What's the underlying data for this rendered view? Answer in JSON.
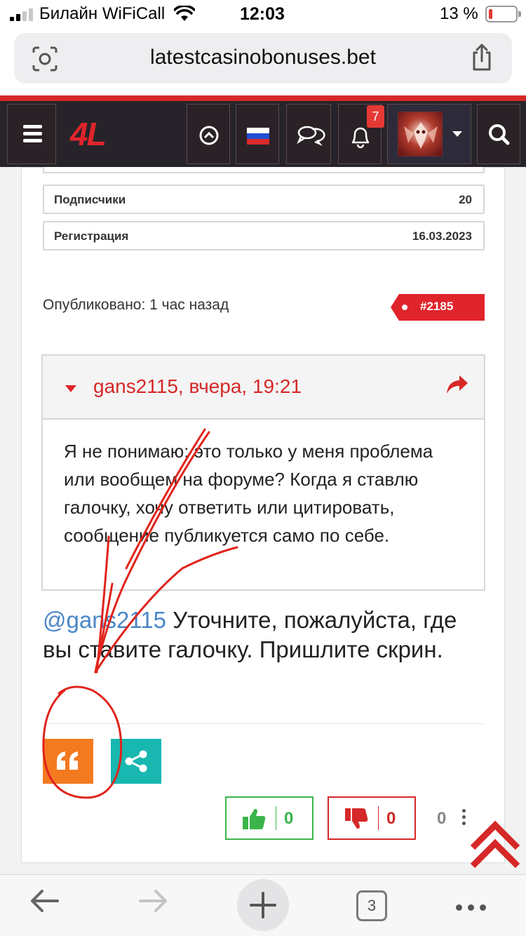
{
  "status_bar": {
    "carrier": "Билайн WiFiCall",
    "time": "12:03",
    "battery": "13 %",
    "battery_level_pct": 13
  },
  "browser": {
    "url": "latestcasinobonuses.bet",
    "tab_count": "3"
  },
  "site_nav": {
    "logo": "4L",
    "notification_count": "7"
  },
  "profile_stats": [
    {
      "label": "Подписчики",
      "value": "20"
    },
    {
      "label": "Регистрация",
      "value": "16.03.2023"
    }
  ],
  "post": {
    "published": "Опубликовано: 1 час назад",
    "number": "#2185",
    "quote_author": "gans2115, вчера, 19:21",
    "quote_text": "Я не понимаю: это только у меня про­блема или вообщем на форуме? Ко­гда я ставлю галочку, хочу ответить или цитировать, сообщение публику­ется само по себе.",
    "reply_mention": "@gans2115",
    "reply_text": " Уточните, пожалуйста, где вы ставите галочку. Пришлите скрин."
  },
  "reactions": {
    "likes": "0",
    "dislikes": "0",
    "score": "0"
  },
  "colors": {
    "brand_red": "#e0242b",
    "nav_bg": "#26242a",
    "quote_button": "#f47a20",
    "share_button": "#18b7b0",
    "like_green": "#3bb54a",
    "mention_blue": "#4a86c8"
  },
  "icons": [
    "wifi-icon",
    "reader-icon",
    "share-icon",
    "hamburger-icon",
    "scroll-up-icon",
    "russian-flag-icon",
    "chat-icon",
    "bell-icon",
    "search-icon",
    "reply-arrow-icon",
    "quote-icon",
    "share-nodes-icon",
    "thumbs-up-icon",
    "thumbs-down-icon",
    "back-icon",
    "forward-icon",
    "plus-icon",
    "more-icon"
  ]
}
